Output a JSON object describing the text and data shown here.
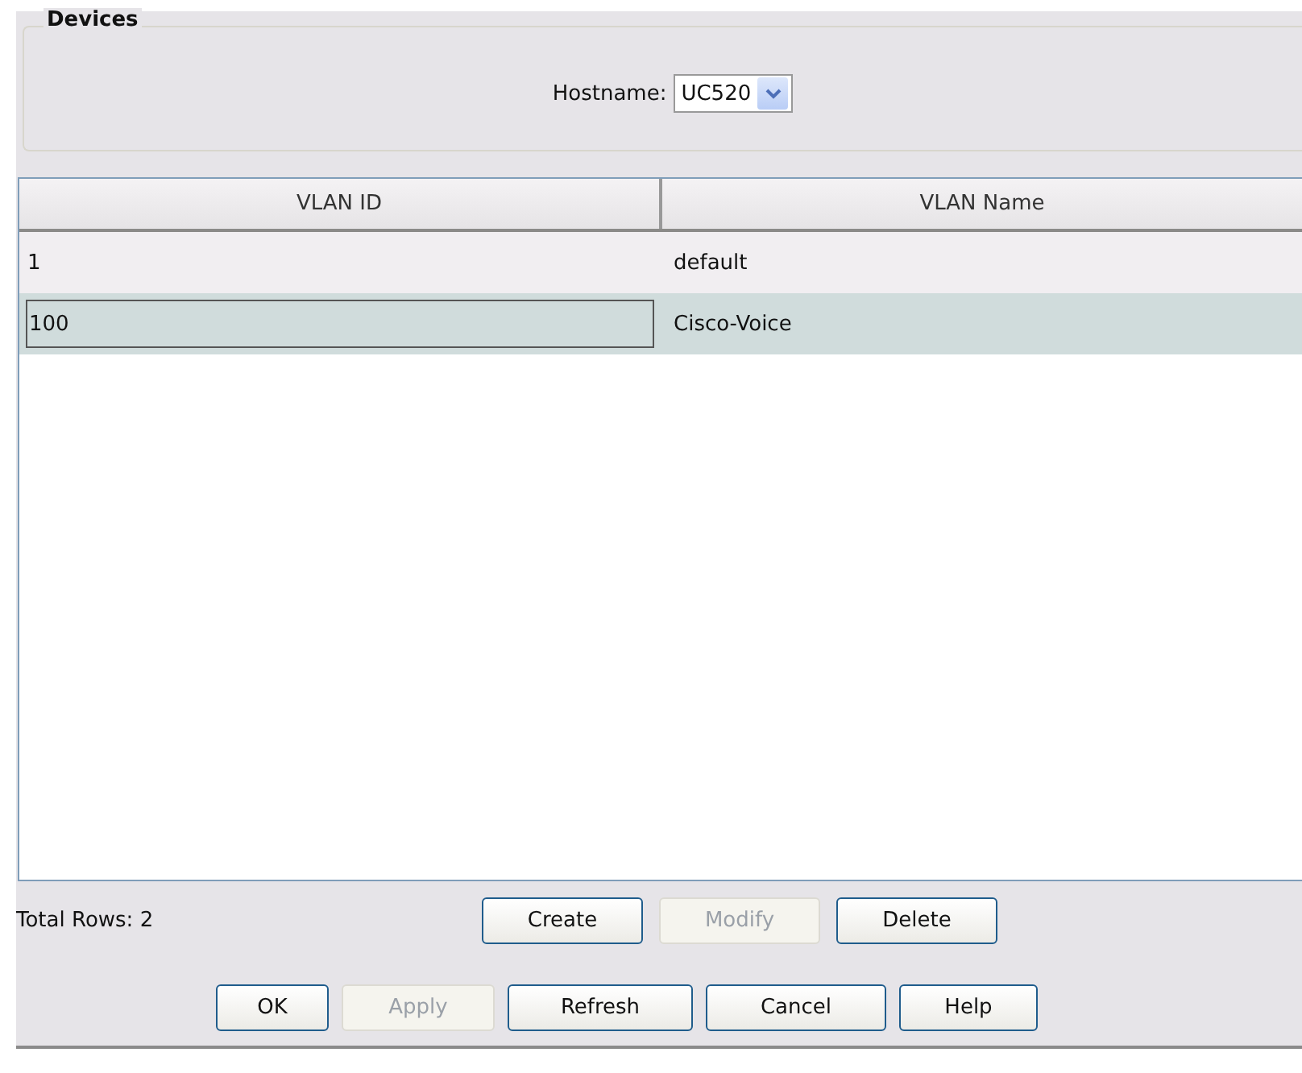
{
  "group": {
    "title": "Devices",
    "hostname": {
      "label": "Hostname:",
      "value": "UC520"
    }
  },
  "table": {
    "columns": [
      "VLAN ID",
      "VLAN Name"
    ],
    "rows": [
      {
        "cells": [
          "1",
          "default"
        ],
        "selected": false
      },
      {
        "cells": [
          "100",
          "Cisco-Voice"
        ],
        "selected": true
      }
    ]
  },
  "total_rows": "Total Rows: 2",
  "table_buttons": [
    {
      "label": "Create",
      "disabled": false
    },
    {
      "label": "Modify",
      "disabled": true
    },
    {
      "label": "Delete",
      "disabled": false
    }
  ],
  "dialog_buttons": [
    {
      "label": "OK",
      "disabled": false
    },
    {
      "label": "Apply",
      "disabled": true
    },
    {
      "label": "Refresh",
      "disabled": false
    },
    {
      "label": "Cancel",
      "disabled": false
    },
    {
      "label": "Help",
      "disabled": false
    }
  ]
}
